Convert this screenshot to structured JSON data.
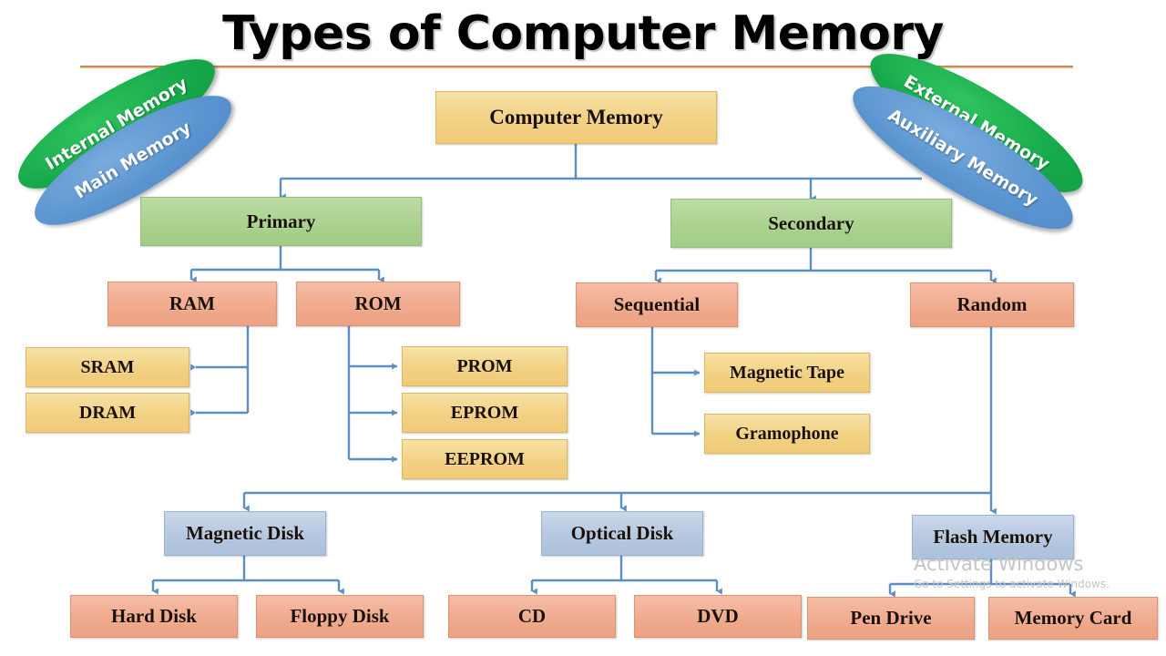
{
  "title": {
    "text": "Types of Computer Memory"
  },
  "callouts": [
    {
      "label": "Internal Memory",
      "color": "#16a94a",
      "side": "left"
    },
    {
      "label": "Main Memory",
      "color": "#5b95d0",
      "side": "left"
    },
    {
      "label": "External Memory",
      "color": "#16a94a",
      "side": "right"
    },
    {
      "label": "Auxiliary Memory",
      "color": "#5b95d0",
      "side": "right"
    }
  ],
  "nodes": {
    "root": {
      "label": "Computer Memory",
      "color": "#f2d184",
      "level": "root"
    },
    "primary": {
      "label": "Primary",
      "color": "#a9d18e",
      "level": "1"
    },
    "secondary": {
      "label": "Secondary",
      "color": "#a9d18e",
      "level": "1"
    },
    "ram": {
      "label": "RAM",
      "color": "#efa98c",
      "level": "2"
    },
    "rom": {
      "label": "ROM",
      "color": "#efa98c",
      "level": "2"
    },
    "sequential": {
      "label": "Sequential",
      "color": "#efa98c",
      "level": "2"
    },
    "random": {
      "label": "Random",
      "color": "#efa98c",
      "level": "2"
    },
    "sram": {
      "label": "SRAM",
      "color": "#f2d184",
      "level": "3"
    },
    "dram": {
      "label": "DRAM",
      "color": "#f2d184",
      "level": "3"
    },
    "prom": {
      "label": "PROM",
      "color": "#f2d184",
      "level": "3"
    },
    "eprom": {
      "label": "EPROM",
      "color": "#f2d184",
      "level": "3"
    },
    "eeprom": {
      "label": "EEPROM",
      "color": "#f2d184",
      "level": "3"
    },
    "magnetic_tape": {
      "label": "Magnetic Tape",
      "color": "#f2d184",
      "level": "3"
    },
    "gramophone": {
      "label": "Gramophone",
      "color": "#f2d184",
      "level": "3"
    },
    "magnetic_disk": {
      "label": "Magnetic Disk",
      "color": "#b4c7e0",
      "level": "3"
    },
    "optical_disk": {
      "label": "Optical Disk",
      "color": "#b4c7e0",
      "level": "3"
    },
    "flash_memory": {
      "label": "Flash Memory",
      "color": "#b4c7e0",
      "level": "3"
    },
    "hard_disk": {
      "label": "Hard Disk",
      "color": "#efa98c",
      "level": "4"
    },
    "floppy_disk": {
      "label": "Floppy Disk",
      "color": "#efa98c",
      "level": "4"
    },
    "cd": {
      "label": "CD",
      "color": "#efa98c",
      "level": "4"
    },
    "dvd": {
      "label": "DVD",
      "color": "#efa98c",
      "level": "4"
    },
    "pen_drive": {
      "label": "Pen Drive",
      "color": "#efa98c",
      "level": "4"
    },
    "memory_card": {
      "label": "Memory Card",
      "color": "#efa98c",
      "level": "4"
    }
  },
  "edges": [
    {
      "from": "root",
      "to": "primary"
    },
    {
      "from": "root",
      "to": "secondary"
    },
    {
      "from": "primary",
      "to": "ram"
    },
    {
      "from": "primary",
      "to": "rom"
    },
    {
      "from": "secondary",
      "to": "sequential"
    },
    {
      "from": "secondary",
      "to": "random"
    },
    {
      "from": "ram",
      "to": "sram"
    },
    {
      "from": "ram",
      "to": "dram"
    },
    {
      "from": "rom",
      "to": "prom"
    },
    {
      "from": "rom",
      "to": "eprom"
    },
    {
      "from": "rom",
      "to": "eeprom"
    },
    {
      "from": "sequential",
      "to": "magnetic_tape"
    },
    {
      "from": "sequential",
      "to": "gramophone"
    },
    {
      "from": "random",
      "to": "magnetic_disk"
    },
    {
      "from": "random",
      "to": "optical_disk"
    },
    {
      "from": "random",
      "to": "flash_memory"
    },
    {
      "from": "magnetic_disk",
      "to": "hard_disk"
    },
    {
      "from": "magnetic_disk",
      "to": "floppy_disk"
    },
    {
      "from": "optical_disk",
      "to": "cd"
    },
    {
      "from": "optical_disk",
      "to": "dvd"
    },
    {
      "from": "flash_memory",
      "to": "pen_drive"
    },
    {
      "from": "flash_memory",
      "to": "memory_card"
    }
  ],
  "watermark": {
    "title": "Activate Windows",
    "subtitle": "Go to Settings to activate Windows."
  },
  "colors": {
    "connector": "#5b8fc4",
    "title_rule": "#c0703c",
    "background": "#ffffff"
  }
}
